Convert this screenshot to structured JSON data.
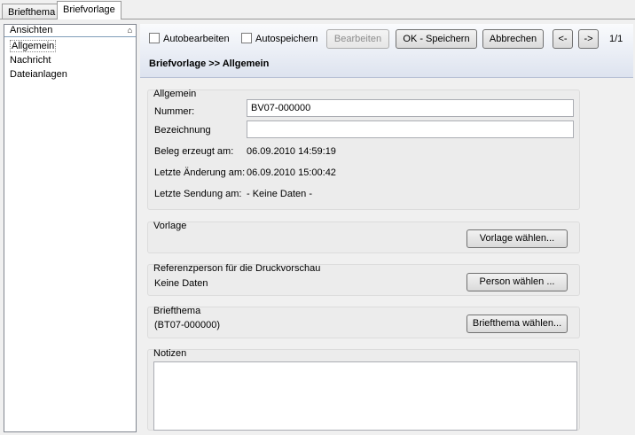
{
  "tabs": [
    "Briefthema",
    "Briefvorlage"
  ],
  "sidebar": {
    "title": "Ansichten",
    "pin_glyph": "⌂",
    "items": [
      "Allgemein",
      "Nachricht",
      "Dateianlagen"
    ]
  },
  "toolbar": {
    "autobearbeiten": "Autobearbeiten",
    "autospeichern": "Autospeichern",
    "bearbeiten": "Bearbeiten",
    "ok_speichern": "OK - Speichern",
    "abbrechen": "Abbrechen",
    "prev": "<-",
    "next": "->",
    "counter": "1/1"
  },
  "title": "Briefvorlage >> Allgemein",
  "allgemein": {
    "title": "Allgemein",
    "nummer_label": "Nummer:",
    "nummer_value": "BV07-000000",
    "bezeichnung_label": "Bezeichnung",
    "bezeichnung_value": "",
    "beleg_label": "Beleg erzeugt am:",
    "beleg_value": "06.09.2010 14:59:19",
    "aenderung_label": "Letzte Änderung am:",
    "aenderung_value": "06.09.2010 15:00:42",
    "sendung_label": "Letzte Sendung am:",
    "sendung_value": "- Keine Daten -"
  },
  "vorlage": {
    "title": "Vorlage",
    "button": "Vorlage wählen..."
  },
  "referenz": {
    "title": "Referenzperson für die Druckvorschau",
    "value": "Keine Daten",
    "button": "Person wählen ..."
  },
  "briefthema": {
    "title": "Briefthema",
    "value": "(BT07-000000)",
    "button": "Briefthema wählen..."
  },
  "notizen": {
    "title": "Notizen"
  }
}
